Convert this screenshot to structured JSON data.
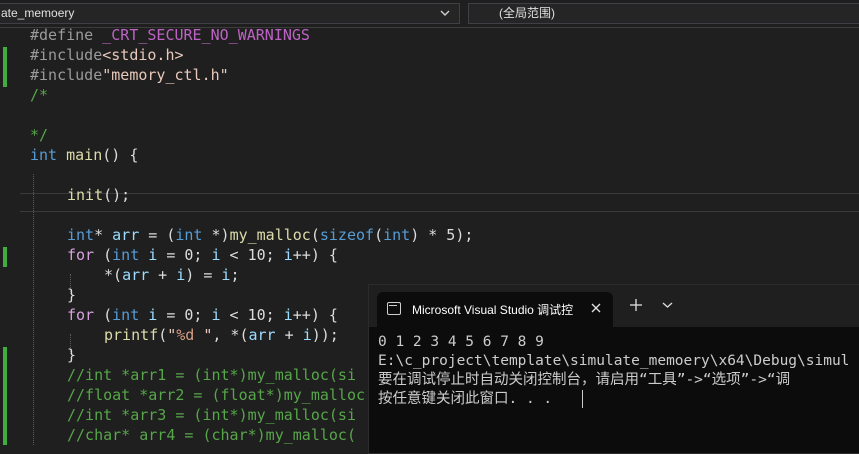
{
  "navbar": {
    "file_dropdown": "ate_memoery",
    "scope_dropdown": "(全局范围)"
  },
  "code": {
    "l1": {
      "pp": "#define ",
      "macro": "_CRT_SECURE_NO_WARNINGS"
    },
    "l2": {
      "pp": "#include",
      "str": "<stdio.h>"
    },
    "l3": {
      "pp": "#include",
      "str": "\"memory_ctl.h\""
    },
    "l4": {
      "cmt": "/*"
    },
    "l6": {
      "cmt": "*/"
    },
    "l7": {
      "kw": "int",
      "fn": "main",
      "rest": "() {"
    },
    "l9": {
      "fn": "init",
      "rest": "();"
    },
    "l11": {
      "a": "int",
      "b": "* ",
      "c": "arr",
      "d": " = (",
      "e": "int",
      "f": " *)",
      "g": "my_malloc",
      "h": "(",
      "i": "sizeof",
      "j": "(",
      "k": "int",
      "l": ") * 5);"
    },
    "l12": {
      "a": "for",
      "b": " (",
      "c": "int",
      "d": " ",
      "e": "i",
      "f": " = 0; ",
      "g": "i",
      "h": " < 10; ",
      "i": "i",
      "j": "++) {"
    },
    "l13": {
      "a": "*(",
      "b": "arr",
      "c": " + ",
      "d": "i",
      "e": ") = ",
      "f": "i",
      "g": ";"
    },
    "l14": {
      "a": "}"
    },
    "l15": {
      "a": "for",
      "b": " (",
      "c": "int",
      "d": " ",
      "e": "i",
      "f": " = 0; ",
      "g": "i",
      "h": " < 10; ",
      "i": "i",
      "j": "++) {"
    },
    "l16": {
      "a": "printf",
      "b": "(",
      "c": "\"",
      "d": "%d",
      "e": " \"",
      "f": ", *(",
      "g": "arr",
      "h": " + ",
      "i": "i",
      "j": "));"
    },
    "l17": {
      "a": "}"
    },
    "l18": {
      "cmt": "//int *arr1 = (int*)my_malloc(si"
    },
    "l19": {
      "cmt": "//float *arr2 = (float*)my_malloc"
    },
    "l20": {
      "cmt": "//int *arr3 = (int*)my_malloc(si"
    },
    "l21": {
      "cmt": "//char* arr4 = (char*)my_malloc("
    }
  },
  "console": {
    "tab_title": "Microsoft Visual Studio 调试控",
    "lines": [
      "0 1 2 3 4 5 6 7 8 9",
      "E:\\c_project\\template\\simulate_memoery\\x64\\Debug\\simul",
      "要在调试停止时自动关闭控制台，请启用“工具”->“选项”->“调",
      "按任意键关闭此窗口. . ."
    ]
  },
  "colors": {
    "editor_bg": "#1f1f1f",
    "console_bg": "#0c0c0c",
    "change_marker": "#3fae3f",
    "keyword": "#569cd6",
    "function": "#dcdcaa",
    "string": "#e8c9bb",
    "comment": "#57a64a",
    "macro": "#bd63c5",
    "control": "#d8a0df"
  }
}
